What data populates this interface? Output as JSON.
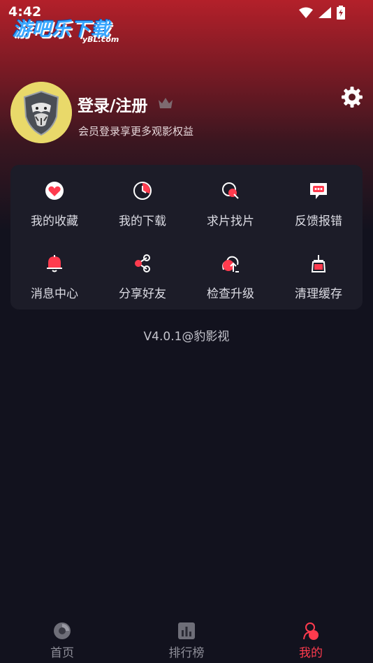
{
  "status_bar": {
    "time": "4:42"
  },
  "watermark": {
    "main": "游吧乐下载",
    "sub": "yBL.com"
  },
  "profile": {
    "title": "登录/注册",
    "subtitle": "会员登录享更多观影权益"
  },
  "menu": {
    "items": [
      {
        "label": "我的收藏",
        "icon": "heart-icon"
      },
      {
        "label": "我的下载",
        "icon": "download-clock-icon"
      },
      {
        "label": "求片找片",
        "icon": "search-film-icon"
      },
      {
        "label": "反馈报错",
        "icon": "feedback-icon"
      },
      {
        "label": "消息中心",
        "icon": "bell-icon"
      },
      {
        "label": "分享好友",
        "icon": "share-icon"
      },
      {
        "label": "检查升级",
        "icon": "upgrade-icon"
      },
      {
        "label": "清理缓存",
        "icon": "broom-icon"
      }
    ]
  },
  "version": "V4.0.1@豹影视",
  "tabs": [
    {
      "label": "首页",
      "icon": "home-icon",
      "active": false
    },
    {
      "label": "排行榜",
      "icon": "ranking-icon",
      "active": false
    },
    {
      "label": "我的",
      "icon": "profile-icon",
      "active": true
    }
  ],
  "colors": {
    "accent": "#ff3b4e",
    "card": "#1c1c28",
    "background": "#12121e"
  }
}
